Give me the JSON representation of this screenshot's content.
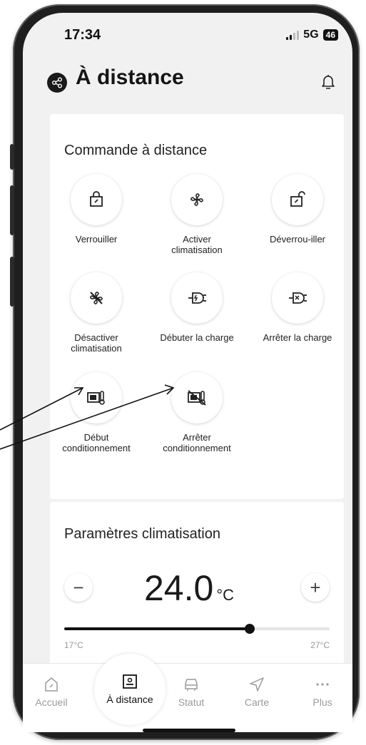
{
  "status_bar": {
    "time": "17:34",
    "network": "5G",
    "battery": "46"
  },
  "header": {
    "title": "À distance",
    "icon": "share-icon",
    "bell_icon": "bell-icon"
  },
  "remote": {
    "title": "Commande à distance",
    "commands": [
      {
        "label": "Verrouiller",
        "icon": "lock-icon"
      },
      {
        "label": "Activer climatisation",
        "icon": "fan-icon"
      },
      {
        "label": "Déverrou-iller",
        "icon": "unlock-icon"
      },
      {
        "label": "Désactiver climatisation",
        "icon": "fan-off-icon"
      },
      {
        "label": "Débuter la charge",
        "icon": "plug-start-icon"
      },
      {
        "label": "Arrêter la charge",
        "icon": "plug-stop-icon"
      },
      {
        "label": "Début conditionnement",
        "icon": "thermo-start-icon"
      },
      {
        "label": "Arrêter conditionnement",
        "icon": "thermo-stop-icon"
      }
    ]
  },
  "climate": {
    "title": "Paramètres climatisation",
    "minus": "−",
    "plus": "+",
    "temperature": "24.0",
    "unit": "°C",
    "min_label": "17°C",
    "max_label": "27°C",
    "min": 17,
    "max": 27
  },
  "nav": {
    "items": [
      {
        "label": "Accueil",
        "icon": "home-icon"
      },
      {
        "label": "À distance",
        "icon": "remote-icon",
        "active": true
      },
      {
        "label": "Statut",
        "icon": "car-icon"
      },
      {
        "label": "Carte",
        "icon": "navigation-icon"
      },
      {
        "label": "Plus",
        "icon": "more-icon"
      }
    ]
  }
}
